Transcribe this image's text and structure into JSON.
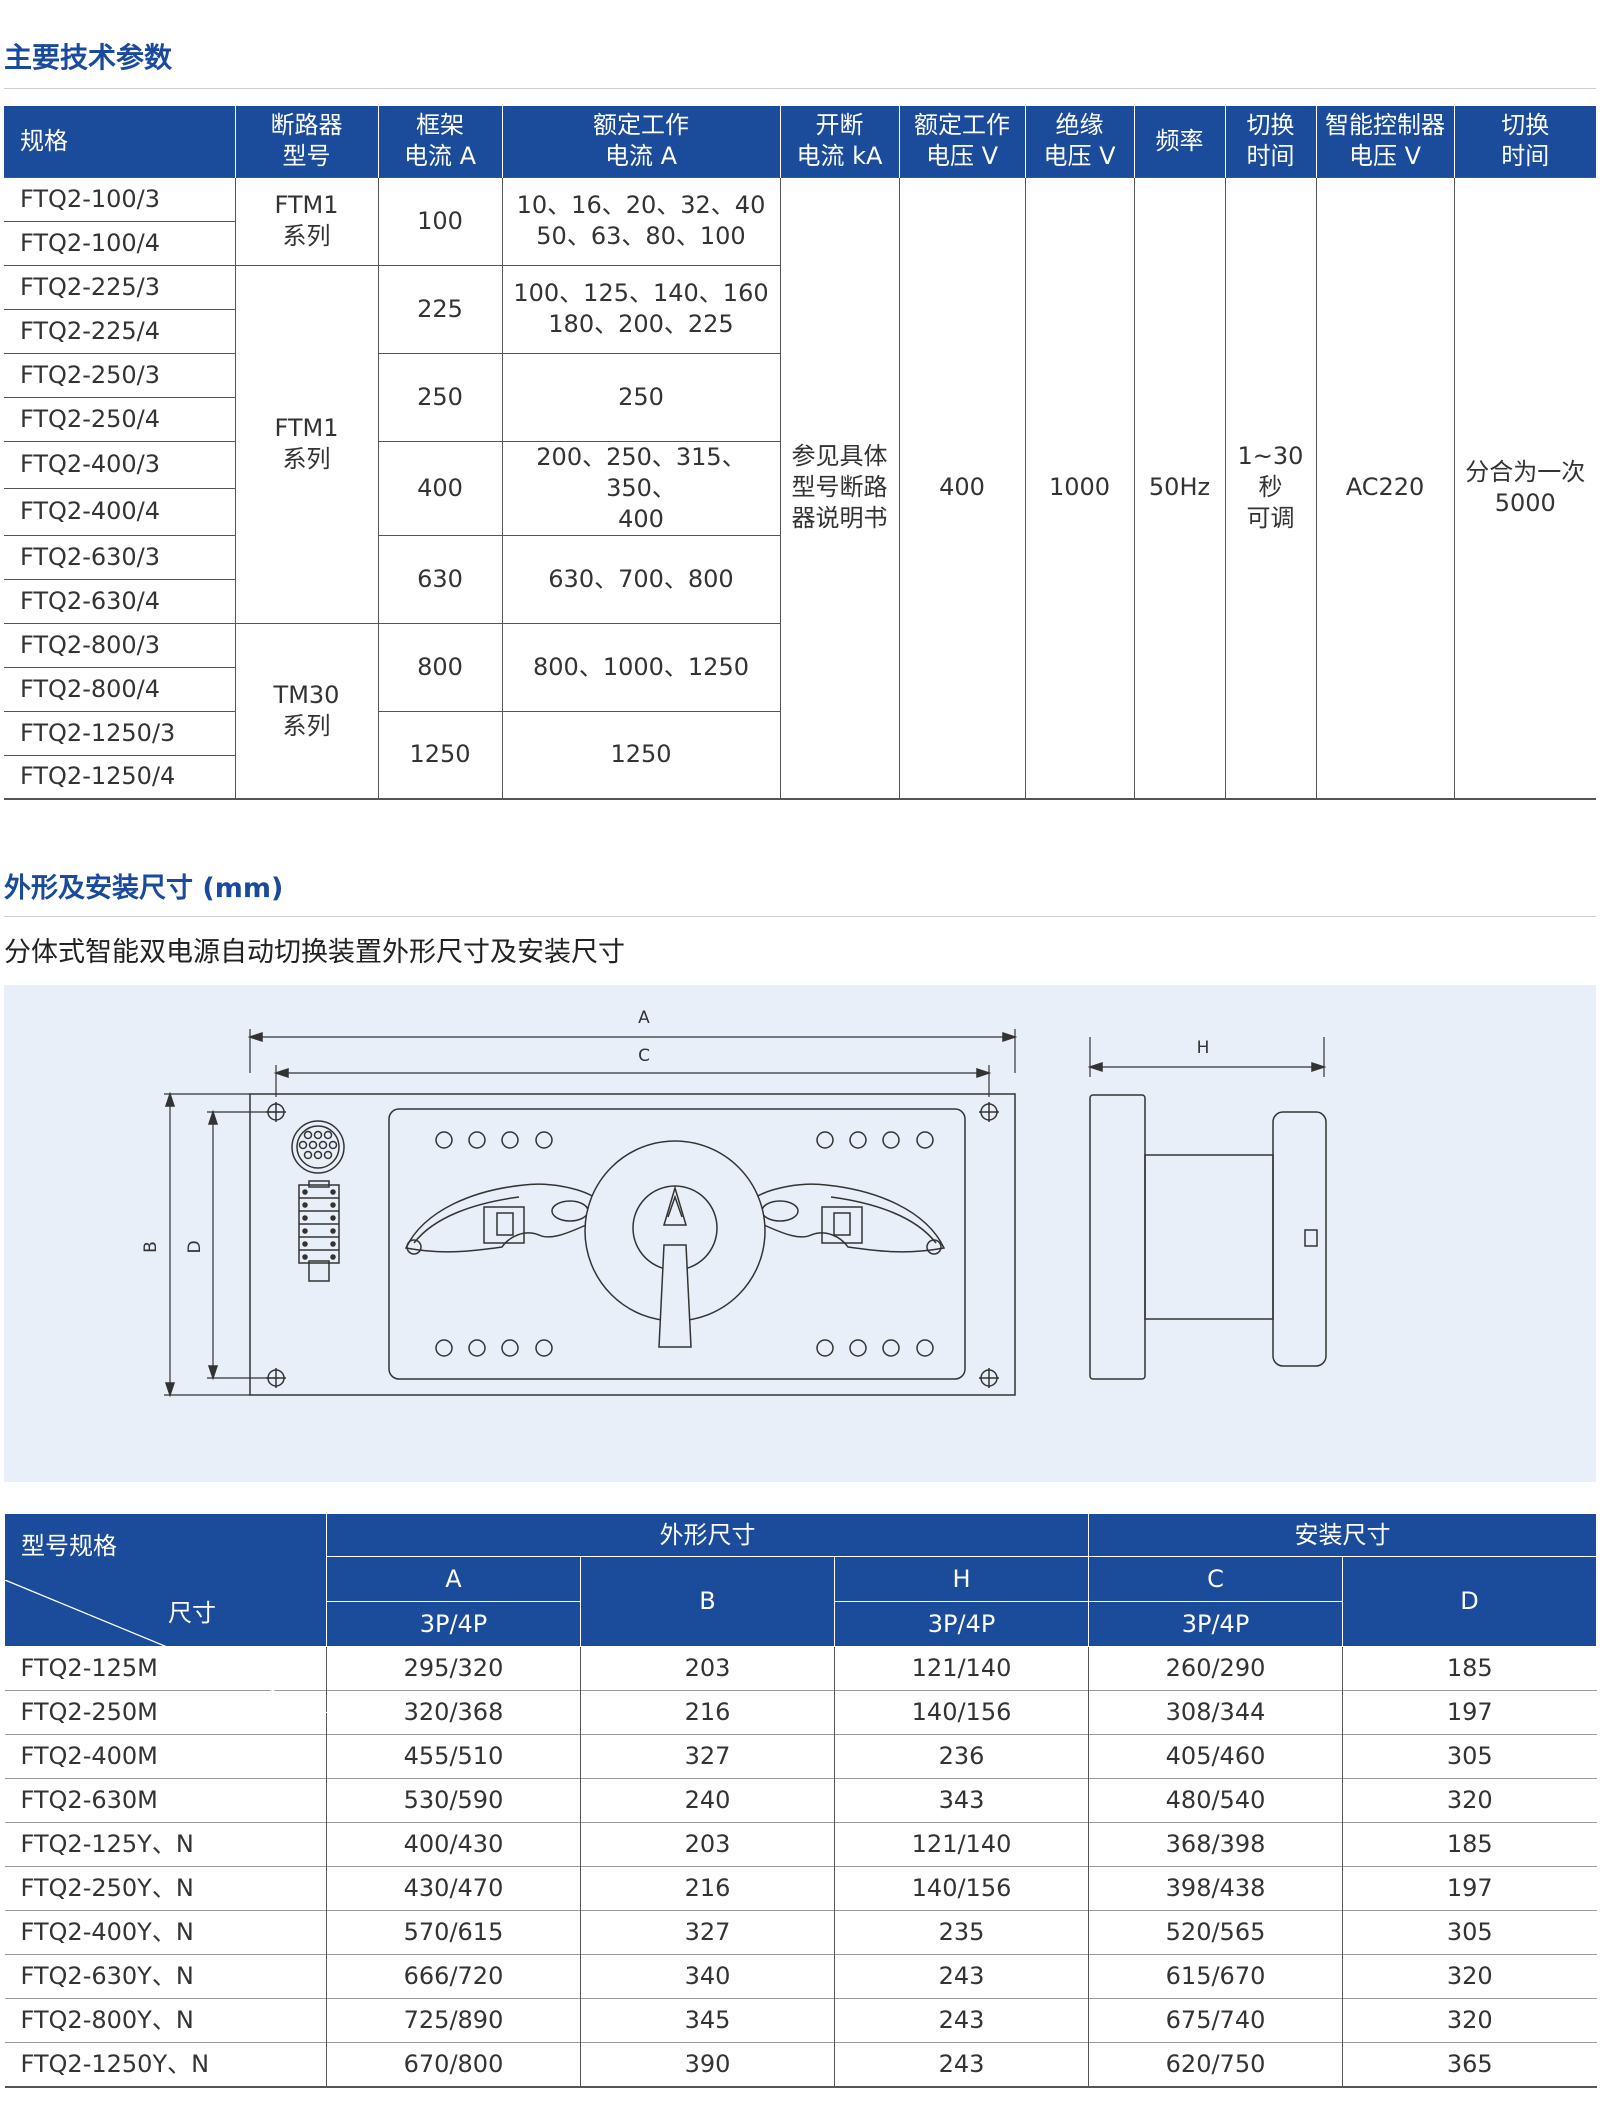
{
  "section1": {
    "title": "主要技术参数"
  },
  "table1": {
    "headers": {
      "spec": "规格",
      "breaker": [
        "断路器",
        "型号"
      ],
      "frame": [
        "框架",
        "电流 A"
      ],
      "rated_current": [
        "额定工作",
        "电流 A"
      ],
      "breaking": [
        "开断",
        "电流 kA"
      ],
      "rated_voltage": [
        "额定工作",
        "电压 V"
      ],
      "insulation": [
        "绝缘",
        "电压 V"
      ],
      "frequency": "频率",
      "switch_time": [
        "切换",
        "时间"
      ],
      "controller": [
        "智能控制器",
        "电压 V"
      ],
      "switch_count": [
        "切换",
        "时间"
      ]
    },
    "specs": [
      "FTQ2-100/3",
      "FTQ2-100/4",
      "FTQ2-225/3",
      "FTQ2-225/4",
      "FTQ2-250/3",
      "FTQ2-250/4",
      "FTQ2-400/3",
      "FTQ2-400/4",
      "FTQ2-630/3",
      "FTQ2-630/4",
      "FTQ2-800/3",
      "FTQ2-800/4",
      "FTQ2-1250/3",
      "FTQ2-1250/4"
    ],
    "breakers": [
      [
        "FTM1",
        "系列"
      ],
      [
        "FTM1",
        "系列"
      ],
      [
        "TM30",
        "系列"
      ]
    ],
    "frames": [
      "100",
      "225",
      "250",
      "400",
      "630",
      "800",
      "1250"
    ],
    "rated_currents": [
      [
        "10、16、20、32、40",
        "50、63、80、100"
      ],
      [
        "100、125、140、160",
        "180、200、225"
      ],
      [
        "250"
      ],
      [
        "200、250、315、350、",
        "400"
      ],
      [
        "630、700、800"
      ],
      [
        "800、1000、1250"
      ],
      [
        "1250"
      ]
    ],
    "breaking": [
      "参见具体",
      "型号断路",
      "器说明书"
    ],
    "rated_voltage": "400",
    "insulation": "1000",
    "frequency": "50Hz",
    "switch_time": [
      "1~30",
      "秒",
      "可调"
    ],
    "controller": "AC220",
    "switch_count": [
      "分合为一次",
      "5000"
    ]
  },
  "section2": {
    "title": "外形及安装尺寸 (mm)",
    "subtitle": "分体式智能双电源自动切换装置外形尺寸及安装尺寸"
  },
  "diagram": {
    "labels": {
      "A": "A",
      "C": "C",
      "B": "B",
      "D": "D",
      "H": "H"
    }
  },
  "table2": {
    "corner_top": "尺寸",
    "corner_bottom": "型号规格",
    "group_outer": "外形尺寸",
    "group_install": "安装尺寸",
    "cols": {
      "A": "A",
      "B": "B",
      "H": "H",
      "C": "C",
      "D": "D"
    },
    "sub": "3P/4P",
    "rows": [
      [
        "FTQ2-125M",
        "295/320",
        "203",
        "121/140",
        "260/290",
        "185"
      ],
      [
        "FTQ2-250M",
        "320/368",
        "216",
        "140/156",
        "308/344",
        "197"
      ],
      [
        "FTQ2-400M",
        "455/510",
        "327",
        "236",
        "405/460",
        "305"
      ],
      [
        "FTQ2-630M",
        "530/590",
        "240",
        "343",
        "480/540",
        "320"
      ],
      [
        "FTQ2-125Y、N",
        "400/430",
        "203",
        "121/140",
        "368/398",
        "185"
      ],
      [
        "FTQ2-250Y、N",
        "430/470",
        "216",
        "140/156",
        "398/438",
        "197"
      ],
      [
        "FTQ2-400Y、N",
        "570/615",
        "327",
        "235",
        "520/565",
        "305"
      ],
      [
        "FTQ2-630Y、N",
        "666/720",
        "340",
        "243",
        "615/670",
        "320"
      ],
      [
        "FTQ2-800Y、N",
        "725/890",
        "345",
        "243",
        "675/740",
        "320"
      ],
      [
        "FTQ2-1250Y、N",
        "670/800",
        "390",
        "243",
        "620/750",
        "365"
      ]
    ]
  }
}
